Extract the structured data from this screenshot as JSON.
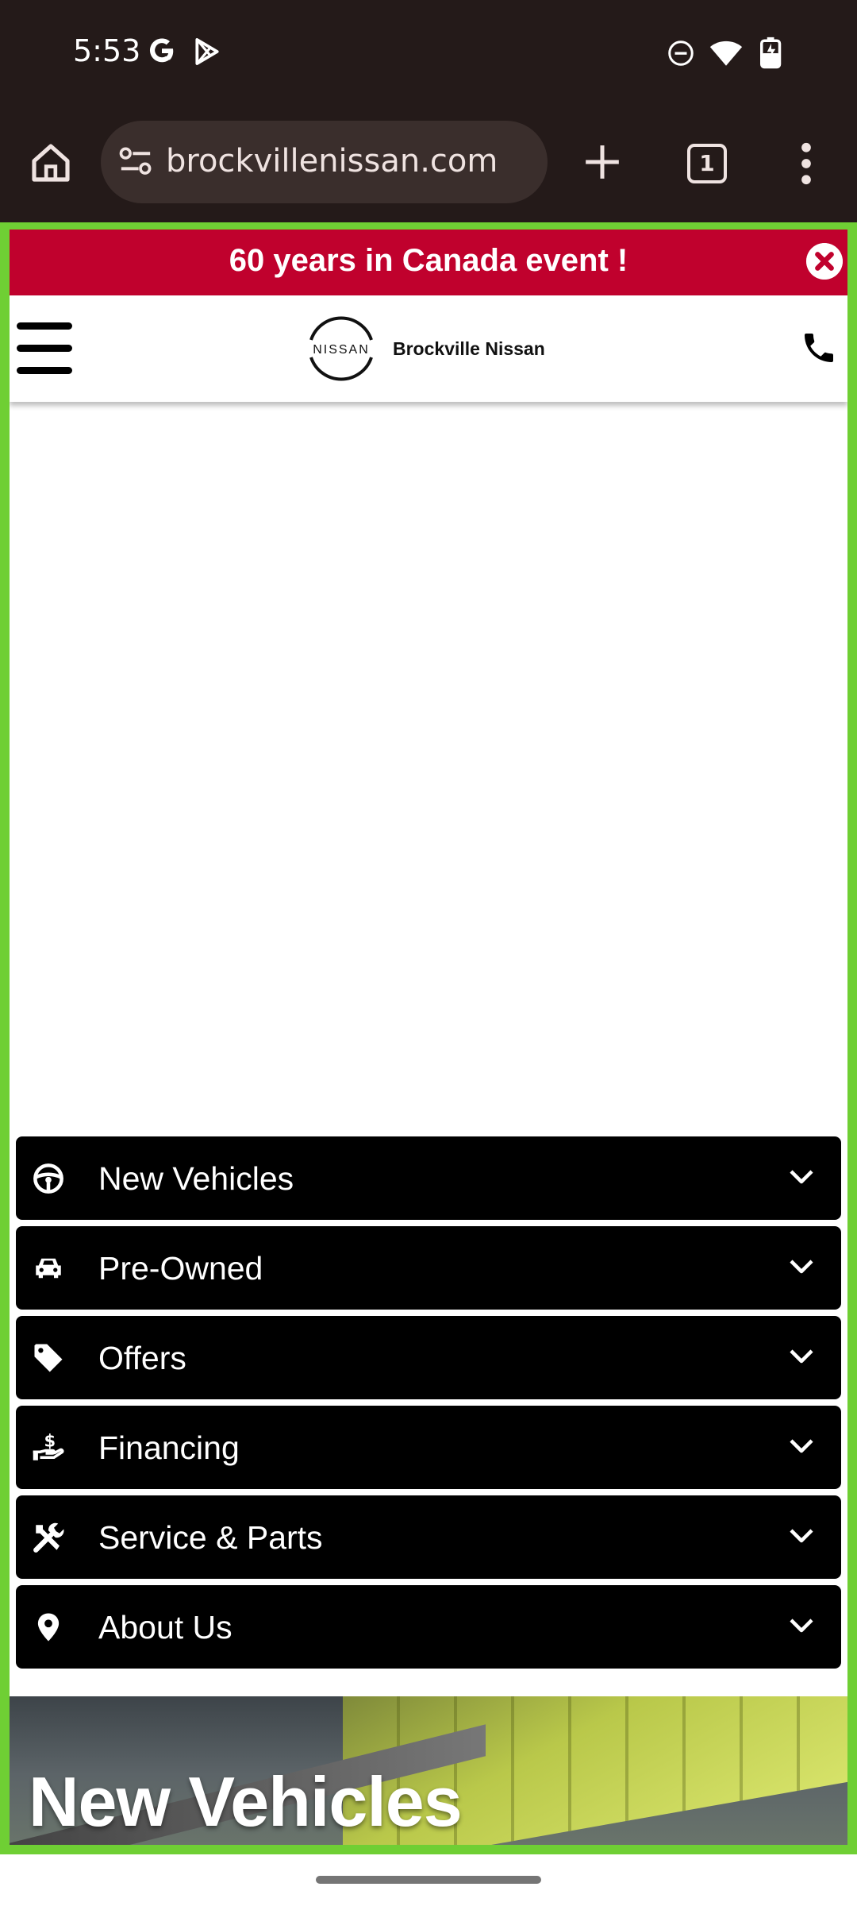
{
  "status_bar": {
    "time": "5:53",
    "left_icons": [
      "google-g-icon",
      "play-store-icon"
    ],
    "right_icons": [
      "do-not-disturb-icon",
      "wifi-icon",
      "battery-charging-icon"
    ]
  },
  "browser": {
    "url": "brockvillenissan.com",
    "tab_count": "1"
  },
  "promo_banner": {
    "text": "60 years in Canada event !",
    "color": "#c0012d"
  },
  "header": {
    "logo_text": "NISSAN",
    "dealer_name": "Brockville Nissan"
  },
  "nav": {
    "items": [
      {
        "label": "New Vehicles",
        "icon": "steering-wheel-icon"
      },
      {
        "label": "Pre-Owned",
        "icon": "car-icon"
      },
      {
        "label": "Offers",
        "icon": "tag-icon"
      },
      {
        "label": "Financing",
        "icon": "hand-dollar-icon"
      },
      {
        "label": "Service & Parts",
        "icon": "tools-icon"
      },
      {
        "label": "About Us",
        "icon": "location-pin-icon"
      }
    ]
  },
  "hero": {
    "title": "New Vehicles"
  },
  "colors": {
    "frame_highlight": "#6fcf34",
    "browser_chrome": "#241a19",
    "nav_background": "#000000"
  }
}
